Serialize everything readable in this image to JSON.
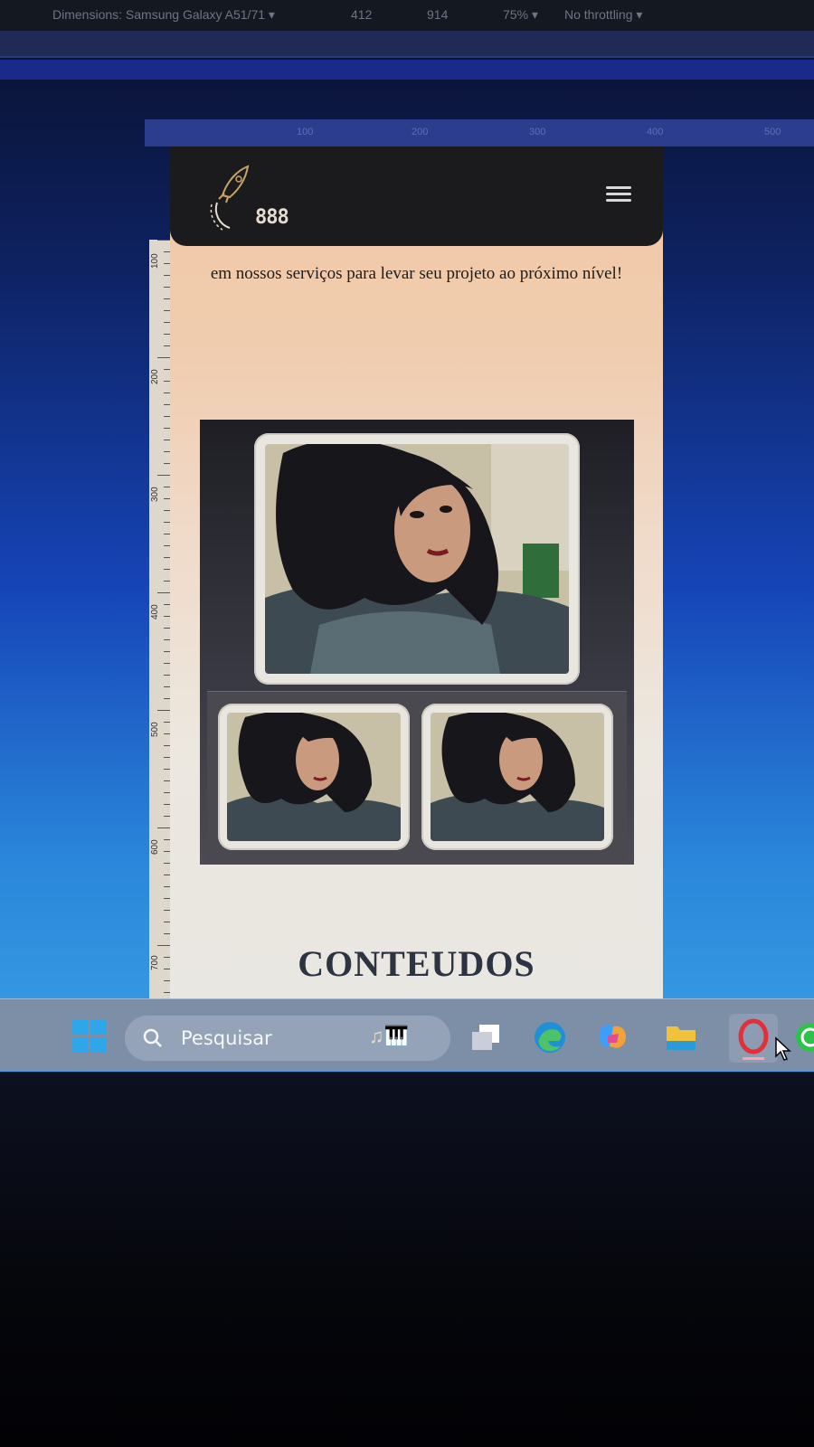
{
  "devtools": {
    "dimensions_label": "Dimensions: Samsung Galaxy A51/71 ▾",
    "width_value": "412",
    "height_value": "914",
    "zoom_label": "75% ▾",
    "throttling_label": "No throttling ▾",
    "ruler_top_marks": [
      "100",
      "200",
      "300",
      "400",
      "500"
    ],
    "ruler_left_marks": [
      "100",
      "200",
      "300",
      "400",
      "500",
      "600",
      "700"
    ]
  },
  "site": {
    "logo_text": "888",
    "intro_text": "em nossos serviços para levar seu projeto ao próximo nível!",
    "section_title": "CONTEUDOS"
  },
  "taskbar": {
    "search_placeholder": "Pesquisar",
    "icons": [
      "windows-start-icon",
      "search-icon",
      "task-view-icon",
      "edge-icon",
      "copilot-icon",
      "file-explorer-icon",
      "opera-icon",
      "whatsapp-icon"
    ]
  },
  "colors": {
    "header_bg": "#1b1b1d",
    "accent_title": "#2c3442",
    "taskbar_bg": "#7d8ea7"
  }
}
